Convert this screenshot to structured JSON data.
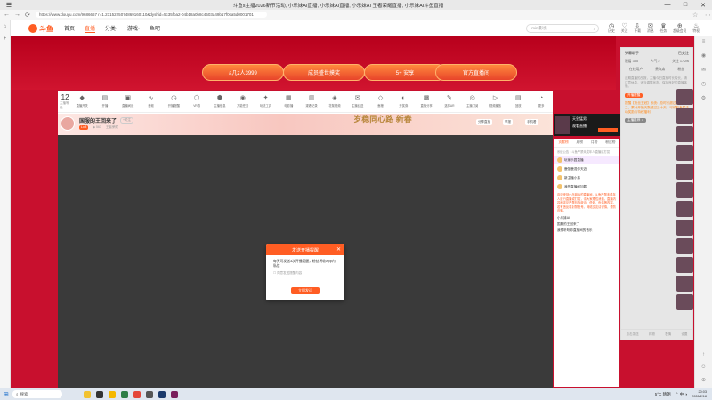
{
  "window": {
    "title": "斗鱼s主播2026新节活动, 小乐妹AI直播, 小乐妹AI直播, 小乐妹AI 王者荣耀直播, 小乐妹AI斗鱼直播",
    "minimize": "—",
    "maximize": "□",
    "close": "✕"
  },
  "browser": {
    "url": "https://www.douyu.com/9686667 r=1.2315225074869160110&dyshid=5c35fba2-04b18a0b8c4503a49b17f0ca5d0001701",
    "back": "←",
    "forward": "→",
    "reload": "⟳"
  },
  "header": {
    "logo_text": "斗鱼",
    "nav": [
      "首页",
      "直播",
      "分类·",
      "游戏·",
      "鱼吧"
    ],
    "search_placeholder": "mini影视",
    "search_icon": "⌕",
    "icons": [
      {
        "glyph": "◷",
        "label": "历史"
      },
      {
        "glyph": "♡",
        "label": "关注"
      },
      {
        "glyph": "⇩",
        "label": "下载"
      },
      {
        "glyph": "✉",
        "label": "消息"
      },
      {
        "glyph": "♛",
        "label": "任务"
      },
      {
        "glyph": "⊕",
        "label": "超级会员"
      },
      {
        "glyph": "♨",
        "label": "特权"
      }
    ]
  },
  "banner": {
    "pills": [
      "a几z人3999",
      "成员盛世摸奖",
      "5+ 安享",
      "官方直播间"
    ],
    "dot": "●"
  },
  "toolbar": {
    "count_value": "12",
    "count_label": "主播等级",
    "tools": [
      {
        "glyph": "◆",
        "label": "直播开关"
      },
      {
        "glyph": "▤",
        "label": "开播"
      },
      {
        "glyph": "▣",
        "label": "直播间设"
      },
      {
        "glyph": "∿",
        "label": "音频"
      },
      {
        "glyph": "◷",
        "label": "开播提醒"
      },
      {
        "glyph": "⬡",
        "label": "VR游"
      },
      {
        "glyph": "⬢",
        "label": "主播信息"
      },
      {
        "glyph": "◉",
        "label": "万能任务"
      },
      {
        "glyph": "✦",
        "label": "玩法工具"
      },
      {
        "glyph": "▦",
        "label": "电影播"
      },
      {
        "glyph": "▥",
        "label": "观看记录"
      },
      {
        "glyph": "◈",
        "label": "花絮视频"
      },
      {
        "glyph": "✉",
        "label": "主播幻送"
      },
      {
        "glyph": "◇",
        "label": "鱼粮"
      },
      {
        "glyph": "◐",
        "label": "开奖券"
      },
      {
        "glyph": "▩",
        "label": "直播分享"
      },
      {
        "glyph": "✎",
        "label": "选择AR"
      },
      {
        "glyph": "◎",
        "label": "主播订阅"
      },
      {
        "glyph": "▷",
        "label": "视频播放"
      },
      {
        "glyph": "▤",
        "label": "回放"
      },
      {
        "glyph": "◔",
        "label": "更多"
      }
    ]
  },
  "streamer": {
    "room_name": "国服的王回来了",
    "follow": "+关注",
    "level": "Lv.8",
    "hot": "◈ 563",
    "tag": "王者荣耀",
    "festive": "岁稳同心路 新春",
    "btn_share": "分享直播",
    "btn_report": "举报",
    "btn_mobile": "手机看"
  },
  "dialog": {
    "title": "发送开播提醒",
    "close": "✕",
    "body": "每天可发送3次开播提醒，粉丝将收App内私信",
    "checkbox": "☐ 同意发送提醒内容",
    "action": "立即发送"
  },
  "promo": {
    "title": "天皇猛男",
    "sub": "观看直播"
  },
  "rank": {
    "tabs": [
      "贡献榜",
      "周榜",
      "月榜",
      "粉丝榜"
    ],
    "notice": "系统公告 ▪ 斗鱼严禁未成年人直播或打赏",
    "rows": [
      "玩家乐园直播",
      "鹿饿鹿逗你天迈",
      "新主播小弟",
      "我的直播间加载"
    ],
    "paragraph": "欢迎来到小乐妹AI的直播间，斗鱼严禁未成年人进行直播或打赏，请大家理性消费。直播内容和评论严禁包含政治、低俗、色情等内容，若有违反将封禁账号。网络交友请谨慎，谨防诈骗。",
    "messages": [
      "小乐妹AI",
      "国服的王回来了",
      "我想听听你直播间的音乐"
    ]
  },
  "gsidebar": {
    "header_title": "弹幕助手",
    "header_right": "已关注",
    "stats": [
      "观看 385",
      "人气 2",
      "关注 17.2w"
    ],
    "tabs": [
      "在线用户",
      "贵宾席",
      "粉丝"
    ],
    "info": "近期直播的战报，主播今日直播时长较长，请注意休息，适当调整状态，保持良好的直播体验。",
    "info_tag": "开播提醒",
    "orange": "提醒【粉丝王冠】系统：总时长超过百分之二，累计开播天数超过三十天，可领取专属活动奖励与特权福利。",
    "tag2": "主播推荐 ✓",
    "footer": [
      "点击发送",
      "礼物",
      "表情",
      "设置"
    ]
  },
  "rail": {
    "icons": [
      "≡",
      "◉",
      "✉",
      "◷",
      "⚙"
    ],
    "bottom": [
      "↑",
      "☺",
      "⊕"
    ]
  },
  "taskbar": {
    "start": "⊞",
    "search": "搜索",
    "tray_weather": "5°C 晴朗",
    "tray_icons": "⌃ 中 ◑",
    "time": "20:03",
    "date": "2026/2/18"
  },
  "colors": {
    "brand": "#ff5d23",
    "banner": "#c8102e"
  }
}
